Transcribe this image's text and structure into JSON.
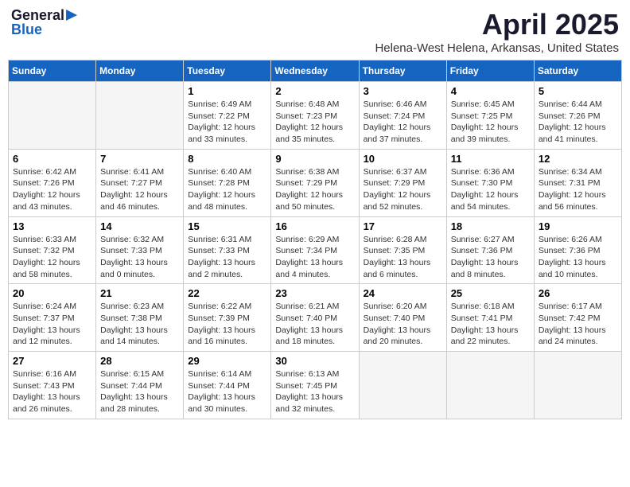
{
  "header": {
    "logo_general": "General",
    "logo_blue": "Blue",
    "month_title": "April 2025",
    "location": "Helena-West Helena, Arkansas, United States"
  },
  "days_of_week": [
    "Sunday",
    "Monday",
    "Tuesday",
    "Wednesday",
    "Thursday",
    "Friday",
    "Saturday"
  ],
  "weeks": [
    [
      {
        "day": "",
        "info": ""
      },
      {
        "day": "",
        "info": ""
      },
      {
        "day": "1",
        "info": "Sunrise: 6:49 AM\nSunset: 7:22 PM\nDaylight: 12 hours and 33 minutes."
      },
      {
        "day": "2",
        "info": "Sunrise: 6:48 AM\nSunset: 7:23 PM\nDaylight: 12 hours and 35 minutes."
      },
      {
        "day": "3",
        "info": "Sunrise: 6:46 AM\nSunset: 7:24 PM\nDaylight: 12 hours and 37 minutes."
      },
      {
        "day": "4",
        "info": "Sunrise: 6:45 AM\nSunset: 7:25 PM\nDaylight: 12 hours and 39 minutes."
      },
      {
        "day": "5",
        "info": "Sunrise: 6:44 AM\nSunset: 7:26 PM\nDaylight: 12 hours and 41 minutes."
      }
    ],
    [
      {
        "day": "6",
        "info": "Sunrise: 6:42 AM\nSunset: 7:26 PM\nDaylight: 12 hours and 43 minutes."
      },
      {
        "day": "7",
        "info": "Sunrise: 6:41 AM\nSunset: 7:27 PM\nDaylight: 12 hours and 46 minutes."
      },
      {
        "day": "8",
        "info": "Sunrise: 6:40 AM\nSunset: 7:28 PM\nDaylight: 12 hours and 48 minutes."
      },
      {
        "day": "9",
        "info": "Sunrise: 6:38 AM\nSunset: 7:29 PM\nDaylight: 12 hours and 50 minutes."
      },
      {
        "day": "10",
        "info": "Sunrise: 6:37 AM\nSunset: 7:29 PM\nDaylight: 12 hours and 52 minutes."
      },
      {
        "day": "11",
        "info": "Sunrise: 6:36 AM\nSunset: 7:30 PM\nDaylight: 12 hours and 54 minutes."
      },
      {
        "day": "12",
        "info": "Sunrise: 6:34 AM\nSunset: 7:31 PM\nDaylight: 12 hours and 56 minutes."
      }
    ],
    [
      {
        "day": "13",
        "info": "Sunrise: 6:33 AM\nSunset: 7:32 PM\nDaylight: 12 hours and 58 minutes."
      },
      {
        "day": "14",
        "info": "Sunrise: 6:32 AM\nSunset: 7:33 PM\nDaylight: 13 hours and 0 minutes."
      },
      {
        "day": "15",
        "info": "Sunrise: 6:31 AM\nSunset: 7:33 PM\nDaylight: 13 hours and 2 minutes."
      },
      {
        "day": "16",
        "info": "Sunrise: 6:29 AM\nSunset: 7:34 PM\nDaylight: 13 hours and 4 minutes."
      },
      {
        "day": "17",
        "info": "Sunrise: 6:28 AM\nSunset: 7:35 PM\nDaylight: 13 hours and 6 minutes."
      },
      {
        "day": "18",
        "info": "Sunrise: 6:27 AM\nSunset: 7:36 PM\nDaylight: 13 hours and 8 minutes."
      },
      {
        "day": "19",
        "info": "Sunrise: 6:26 AM\nSunset: 7:36 PM\nDaylight: 13 hours and 10 minutes."
      }
    ],
    [
      {
        "day": "20",
        "info": "Sunrise: 6:24 AM\nSunset: 7:37 PM\nDaylight: 13 hours and 12 minutes."
      },
      {
        "day": "21",
        "info": "Sunrise: 6:23 AM\nSunset: 7:38 PM\nDaylight: 13 hours and 14 minutes."
      },
      {
        "day": "22",
        "info": "Sunrise: 6:22 AM\nSunset: 7:39 PM\nDaylight: 13 hours and 16 minutes."
      },
      {
        "day": "23",
        "info": "Sunrise: 6:21 AM\nSunset: 7:40 PM\nDaylight: 13 hours and 18 minutes."
      },
      {
        "day": "24",
        "info": "Sunrise: 6:20 AM\nSunset: 7:40 PM\nDaylight: 13 hours and 20 minutes."
      },
      {
        "day": "25",
        "info": "Sunrise: 6:18 AM\nSunset: 7:41 PM\nDaylight: 13 hours and 22 minutes."
      },
      {
        "day": "26",
        "info": "Sunrise: 6:17 AM\nSunset: 7:42 PM\nDaylight: 13 hours and 24 minutes."
      }
    ],
    [
      {
        "day": "27",
        "info": "Sunrise: 6:16 AM\nSunset: 7:43 PM\nDaylight: 13 hours and 26 minutes."
      },
      {
        "day": "28",
        "info": "Sunrise: 6:15 AM\nSunset: 7:44 PM\nDaylight: 13 hours and 28 minutes."
      },
      {
        "day": "29",
        "info": "Sunrise: 6:14 AM\nSunset: 7:44 PM\nDaylight: 13 hours and 30 minutes."
      },
      {
        "day": "30",
        "info": "Sunrise: 6:13 AM\nSunset: 7:45 PM\nDaylight: 13 hours and 32 minutes."
      },
      {
        "day": "",
        "info": ""
      },
      {
        "day": "",
        "info": ""
      },
      {
        "day": "",
        "info": ""
      }
    ]
  ]
}
